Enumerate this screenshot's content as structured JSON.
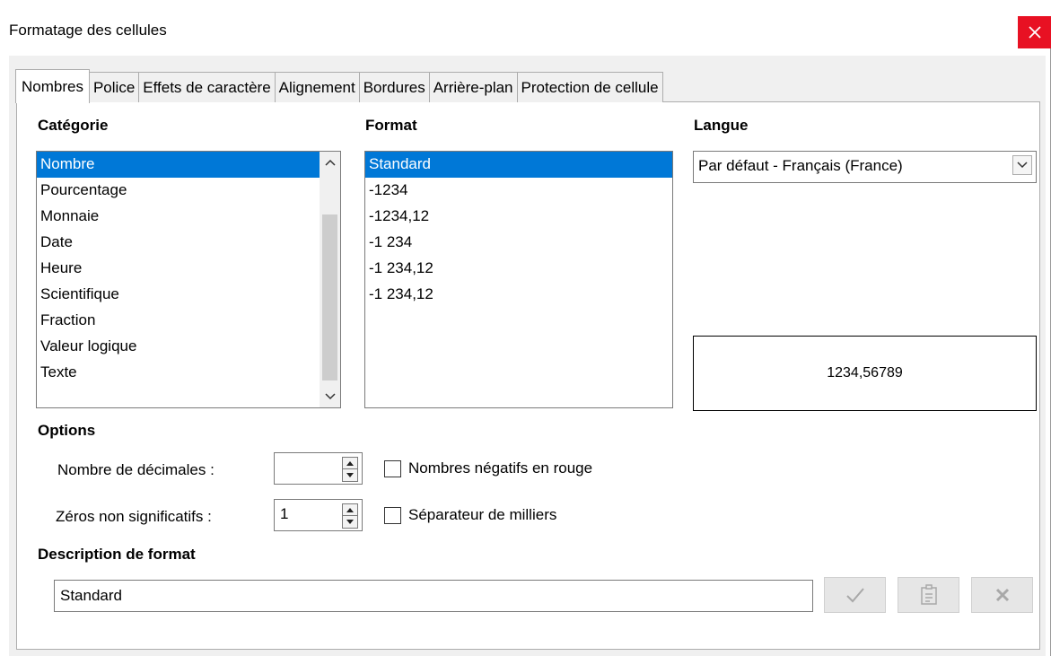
{
  "window": {
    "title": "Formatage des cellules"
  },
  "tabs": [
    {
      "label": "Nombres",
      "active": true
    },
    {
      "label": "Police",
      "active": false
    },
    {
      "label": "Effets de caractère",
      "active": false
    },
    {
      "label": "Alignement",
      "active": false
    },
    {
      "label": "Bordures",
      "active": false
    },
    {
      "label": "Arrière-plan",
      "active": false
    },
    {
      "label": "Protection de cellule",
      "active": false
    }
  ],
  "category": {
    "label": "Catégorie",
    "items": [
      "Nombre",
      "Pourcentage",
      "Monnaie",
      "Date",
      "Heure",
      "Scientifique",
      "Fraction",
      "Valeur logique",
      "Texte"
    ],
    "selected": "Nombre"
  },
  "format": {
    "label": "Format",
    "items": [
      "Standard",
      "-1234",
      "-1234,12",
      "-1 234",
      "-1 234,12",
      "-1 234,12"
    ],
    "selected": "Standard"
  },
  "language": {
    "label": "Langue",
    "value": "Par défaut - Français (France)"
  },
  "preview": {
    "value": "1234,56789"
  },
  "options": {
    "label": "Options",
    "decimals_label": "Nombre de décimales :",
    "decimals_value": "",
    "leading_zeros_label": "Zéros non significatifs :",
    "leading_zeros_value": "1",
    "negative_red_label": "Nombres négatifs en rouge",
    "negative_red_checked": false,
    "thousands_sep_label": "Séparateur de milliers",
    "thousands_sep_checked": false
  },
  "format_code": {
    "label": "Description de format",
    "value": "Standard"
  },
  "icons": {
    "close": "close-icon",
    "accept": "checkmark-icon",
    "comment": "comment-icon",
    "delete": "delete-icon"
  },
  "colors": {
    "accent": "#0078d7",
    "close_bg": "#e81123"
  }
}
